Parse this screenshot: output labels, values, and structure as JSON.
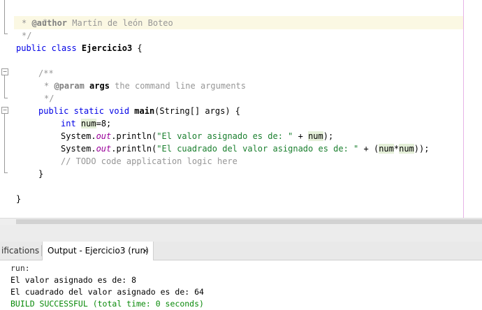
{
  "editor": {
    "lines": {
      "l1": "*",
      "l2_prefix": "* ",
      "l2_tag": "@author",
      "l2_text": " Martín de león Boteo",
      "l3": "*/",
      "l4_kw": "public class",
      "l4_name": " Ejercicio3",
      "l4_rest": " {",
      "l6": "/**",
      "l7_prefix": "* ",
      "l7_tag": "@param",
      "l7_arg": " args",
      "l7_text": " the command line arguments",
      "l8": "*/",
      "l9_kw": "public static void",
      "l9_name": " main",
      "l9_rest": "(String[] args) {",
      "l10_kw": "int",
      "l10_sp": " ",
      "l10_var": "num",
      "l10_rest": "=8;",
      "l11_a": "System.",
      "l11_out": "out",
      "l11_b": ".println(",
      "l11_str": "\"El valor asignado es de: \"",
      "l11_c": " + ",
      "l11_var": "num",
      "l11_d": ");",
      "l12_a": "System.",
      "l12_out": "out",
      "l12_b": ".println(",
      "l12_str": "\"El cuadrado del valor asignado es de: \"",
      "l12_c": " + (",
      "l12_var1": "num",
      "l12_op": "*",
      "l12_var2": "num",
      "l12_d": "));",
      "l13": "// TODO code application logic here",
      "l14": "}",
      "l16": "}"
    },
    "fold_glyph": "−"
  },
  "panel": {
    "tab_notifications": "ifications",
    "tab_output": "Output - Ejercicio3 (run)",
    "tab_close": "×"
  },
  "output": {
    "lines": [
      "run:",
      "El valor asignado es de: 8",
      "El cuadrado del valor asignado es de: 64",
      "BUILD SUCCESSFUL (total time: 0 seconds)"
    ]
  },
  "colors": {
    "keyword": "#0000e6",
    "comment": "#969696",
    "string": "#ce7b00",
    "success": "#0a8a0a",
    "current_line": "#fbf8e3",
    "occurrence": "#e4efd8"
  }
}
